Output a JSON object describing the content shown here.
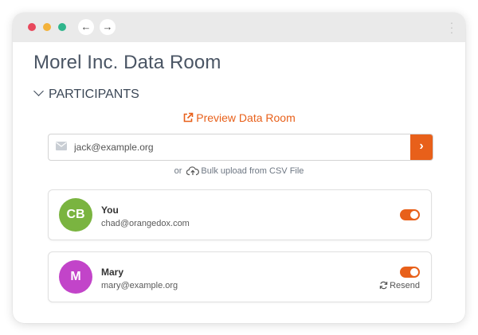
{
  "browser": {
    "back_icon": "arrow-left-icon",
    "forward_icon": "arrow-right-icon",
    "menu_icon": "kebab-icon",
    "back_glyph": "←",
    "forward_glyph": "→",
    "menu_glyph": "⋮"
  },
  "page": {
    "title": "Morel Inc. Data Room"
  },
  "section": {
    "label": "PARTICIPANTS",
    "expanded": true
  },
  "preview": {
    "label": "Preview Data Room",
    "icon": "external-link-icon"
  },
  "invite": {
    "email_value": "jack@example.org",
    "submit_glyph": "›"
  },
  "bulk": {
    "prefix": "or",
    "label": "Bulk upload from CSV File",
    "icon": "cloud-upload-icon"
  },
  "participants": [
    {
      "initials": "CB",
      "name": "You",
      "email": "chad@orangedox.com",
      "avatar_color": "#7ab440",
      "enabled": true
    },
    {
      "initials": "M",
      "name": "Mary",
      "email": "mary@example.org",
      "avatar_color": "#c244c9",
      "enabled": true,
      "action_label": "Resend"
    }
  ],
  "colors": {
    "accent": "#e8601a"
  }
}
